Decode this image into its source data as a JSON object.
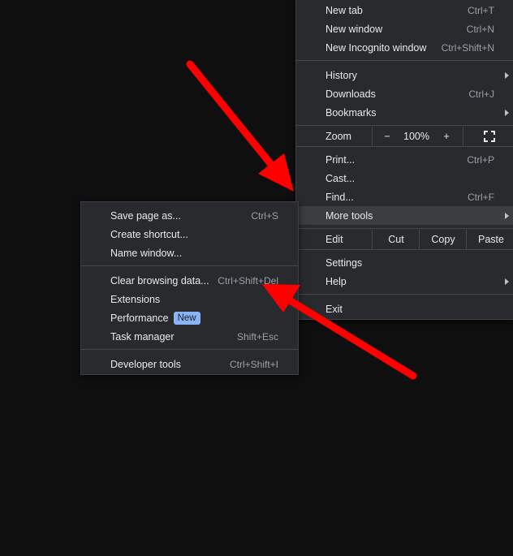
{
  "main_menu": {
    "new_tab": {
      "label": "New tab",
      "shortcut": "Ctrl+T"
    },
    "new_window": {
      "label": "New window",
      "shortcut": "Ctrl+N"
    },
    "new_incognito": {
      "label": "New Incognito window",
      "shortcut": "Ctrl+Shift+N"
    },
    "history": {
      "label": "History"
    },
    "downloads": {
      "label": "Downloads",
      "shortcut": "Ctrl+J"
    },
    "bookmarks": {
      "label": "Bookmarks"
    },
    "zoom": {
      "label": "Zoom",
      "minus": "−",
      "value": "100%",
      "plus": "+",
      "fullscreen_icon": "fullscreen-icon"
    },
    "print": {
      "label": "Print...",
      "shortcut": "Ctrl+P"
    },
    "cast": {
      "label": "Cast..."
    },
    "find": {
      "label": "Find...",
      "shortcut": "Ctrl+F"
    },
    "more_tools": {
      "label": "More tools"
    },
    "edit": {
      "label": "Edit",
      "cut": "Cut",
      "copy": "Copy",
      "paste": "Paste"
    },
    "settings": {
      "label": "Settings"
    },
    "help": {
      "label": "Help"
    },
    "exit": {
      "label": "Exit"
    }
  },
  "sub_menu": {
    "save_page": {
      "label": "Save page as...",
      "shortcut": "Ctrl+S"
    },
    "create_shortcut": {
      "label": "Create shortcut..."
    },
    "name_window": {
      "label": "Name window..."
    },
    "clear_browsing": {
      "label": "Clear browsing data...",
      "shortcut": "Ctrl+Shift+Del"
    },
    "extensions": {
      "label": "Extensions"
    },
    "performance": {
      "label": "Performance",
      "badge": "New"
    },
    "task_manager": {
      "label": "Task manager",
      "shortcut": "Shift+Esc"
    },
    "developer_tools": {
      "label": "Developer tools",
      "shortcut": "Ctrl+Shift+I"
    }
  },
  "colors": {
    "menu_bg": "#292a2d",
    "highlight": "#3c3d41",
    "annotation_arrow": "#ff0000",
    "badge_bg": "#8ab4f8"
  }
}
